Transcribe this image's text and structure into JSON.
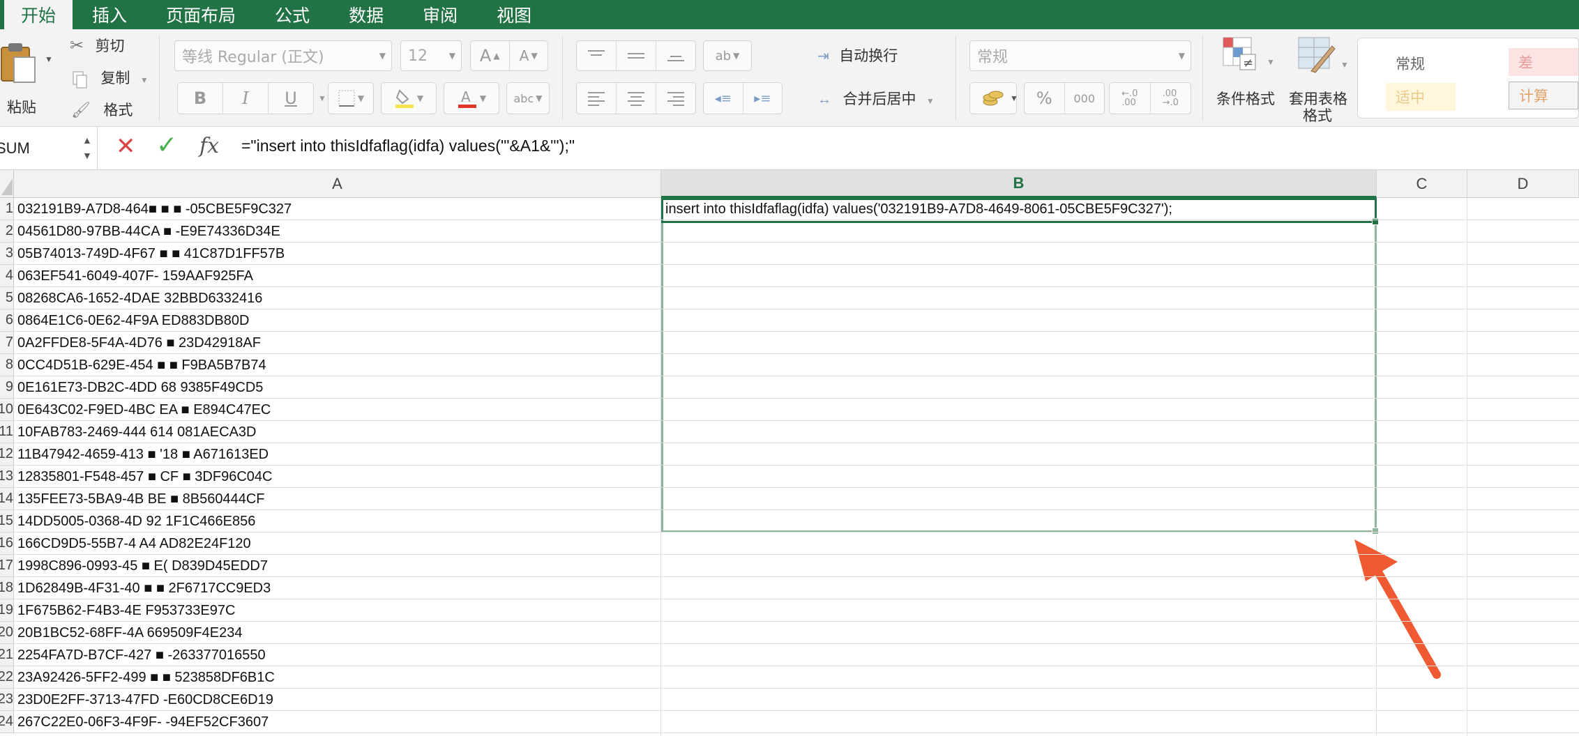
{
  "tabs": [
    "开始",
    "插入",
    "页面布局",
    "公式",
    "数据",
    "审阅",
    "视图"
  ],
  "clipboard": {
    "paste": "粘贴",
    "cut": "剪切",
    "copy": "复制",
    "format": "格式"
  },
  "font": {
    "name": "等线 Regular (正文)",
    "size": "12"
  },
  "alignment": {
    "wrap": "自动换行",
    "merge": "合并后居中"
  },
  "number": {
    "format": "常规"
  },
  "styles": {
    "conditional": "条件格式",
    "table_line1": "套用表格",
    "table_line2": "格式",
    "cells": [
      "常规",
      "差",
      "适中",
      "计算"
    ]
  },
  "formula_bar": {
    "name_box": "SUM",
    "formula": "=\"insert into thisIdfaflag(idfa) values('\"&A1&\"');\""
  },
  "columns": [
    "A",
    "B",
    "C",
    "D"
  ],
  "rows": [
    {
      "num": "1",
      "a": "032191B9-A7D8-4649-8061-05CBE5F9C327",
      "b": "insert into thisIdfaflag(idfa) values('032191B9-A7D8-4649-8061-05CBE5F9C327');"
    },
    {
      "num": "2",
      "a": "04561D80-97BB-44CA-■■■■-E9E74336D34E",
      "b": ""
    },
    {
      "num": "3",
      "a": "05B74013-749D-4F67-■■■■-41C87D1FF57B",
      "b": ""
    },
    {
      "num": "4",
      "a": "063EF541-6049-407F-■■■■-159AAF925FA",
      "b": ""
    },
    {
      "num": "5",
      "a": "08268CA6-1652-4DAE-■■■■-32BBD6332416",
      "b": ""
    },
    {
      "num": "6",
      "a": "0864E1C6-0E62-4F9A-■■■■-ED883DB80D",
      "b": ""
    },
    {
      "num": "7",
      "a": "0A2FFDE8-5F4A-4D76-■■■■-23D42918AF",
      "b": ""
    },
    {
      "num": "8",
      "a": "0CC4D51B-629E-454■-■■■■-F9BA5B7B74",
      "b": ""
    },
    {
      "num": "9",
      "a": "0E161E73-DB2C-4DD■-68■■-9385F49CD5",
      "b": ""
    },
    {
      "num": "10",
      "a": "0E643C02-F9ED-4BC■-EA■■-3E894C47EC",
      "b": ""
    },
    {
      "num": "11",
      "a": "10FAB783-2469-444■-614■-081AECA3D",
      "b": ""
    },
    {
      "num": "12",
      "a": "11B47942-4659-413■-18■■-A671613ED",
      "b": ""
    },
    {
      "num": "13",
      "a": "12835801-F548-457■-CF■■-3DF96C04C",
      "b": ""
    },
    {
      "num": "14",
      "a": "135FEE73-5BA9-4B■-BE■■-8B560444CF",
      "b": ""
    },
    {
      "num": "15",
      "a": "14DD5005-0368-4D■-92■■-1F1C466E856",
      "b": ""
    },
    {
      "num": "16",
      "a": "166CD9D5-55B7-4■-A4■■-AD82E24F120",
      "b": ""
    },
    {
      "num": "17",
      "a": "1998C896-0993-45■-E■■■-D839D45EDD7",
      "b": ""
    },
    {
      "num": "18",
      "a": "1D62849B-4F31-40■-■■■■-2F6717CC9ED3",
      "b": ""
    },
    {
      "num": "19",
      "a": "1F675B62-F4B3-4E■-■■■■-F953733E97C",
      "b": ""
    },
    {
      "num": "20",
      "a": "20B1BC52-68FF-4A9■-■■■■-669509F4E234",
      "b": ""
    },
    {
      "num": "21",
      "a": "2254FA7D-B7CF-427■-■■■■-263377016550",
      "b": ""
    },
    {
      "num": "22",
      "a": "23A92426-5FF2-4992-■■■■-523858DF6B1C",
      "b": ""
    },
    {
      "num": "23",
      "a": "23D0E2FF-3713-47FD-■■■■-E60CD8CE6D19",
      "b": ""
    },
    {
      "num": "24",
      "a": "267C22E0-06F3-4F9F-■■■■-94EF52CF3607",
      "b": ""
    }
  ],
  "cells_shown": [
    "032191B9-A7D8-464■ ■ ■ -05CBE5F9C327",
    "04561D80-97BB-44CA ■ -E9E74336D34E",
    "05B74013-749D-4F67 ■ ■ 41C87D1FF57B",
    "063EF541-6049-407F- 159AAF925FA",
    "08268CA6-1652-4DAE 32BBD6332416",
    "0864E1C6-0E62-4F9A ED883DB80D",
    "0A2FFDE8-5F4A-4D76 ■ 23D42918AF",
    "0CC4D51B-629E-454 ■ ■ F9BA5B7B74",
    "0E161E73-DB2C-4DD 68 9385F49CD5",
    "0E643C02-F9ED-4BC EA ■ E894C47EC",
    "10FAB783-2469-444 614 081AECA3D",
    "11B47942-4659-413 ■ '18 ■ A671613ED",
    "12835801-F548-457 ■ CF ■ 3DF96C04C",
    "135FEE73-5BA9-4B BE ■ 8B560444CF",
    "14DD5005-0368-4D 92 1F1C466E856",
    "166CD9D5-55B7-4 A4 AD82E24F120",
    "1998C896-0993-45 ■ E( D839D45EDD7",
    "1D62849B-4F31-40 ■ ■ 2F6717CC9ED3",
    "1F675B62-F4B3-4E F953733E97C",
    "20B1BC52-68FF-4A 669509F4E234",
    "2254FA7D-B7CF-427 ■ -263377016550",
    "23A92426-5FF2-499 ■ ■ 523858DF6B1C",
    "23D0E2FF-3713-47FD -E60CD8CE6D19",
    "267C22E0-06F3-4F9F- -94EF52CF3607"
  ],
  "colors": {
    "green": "#217346",
    "arrow": "#ef5a32"
  }
}
